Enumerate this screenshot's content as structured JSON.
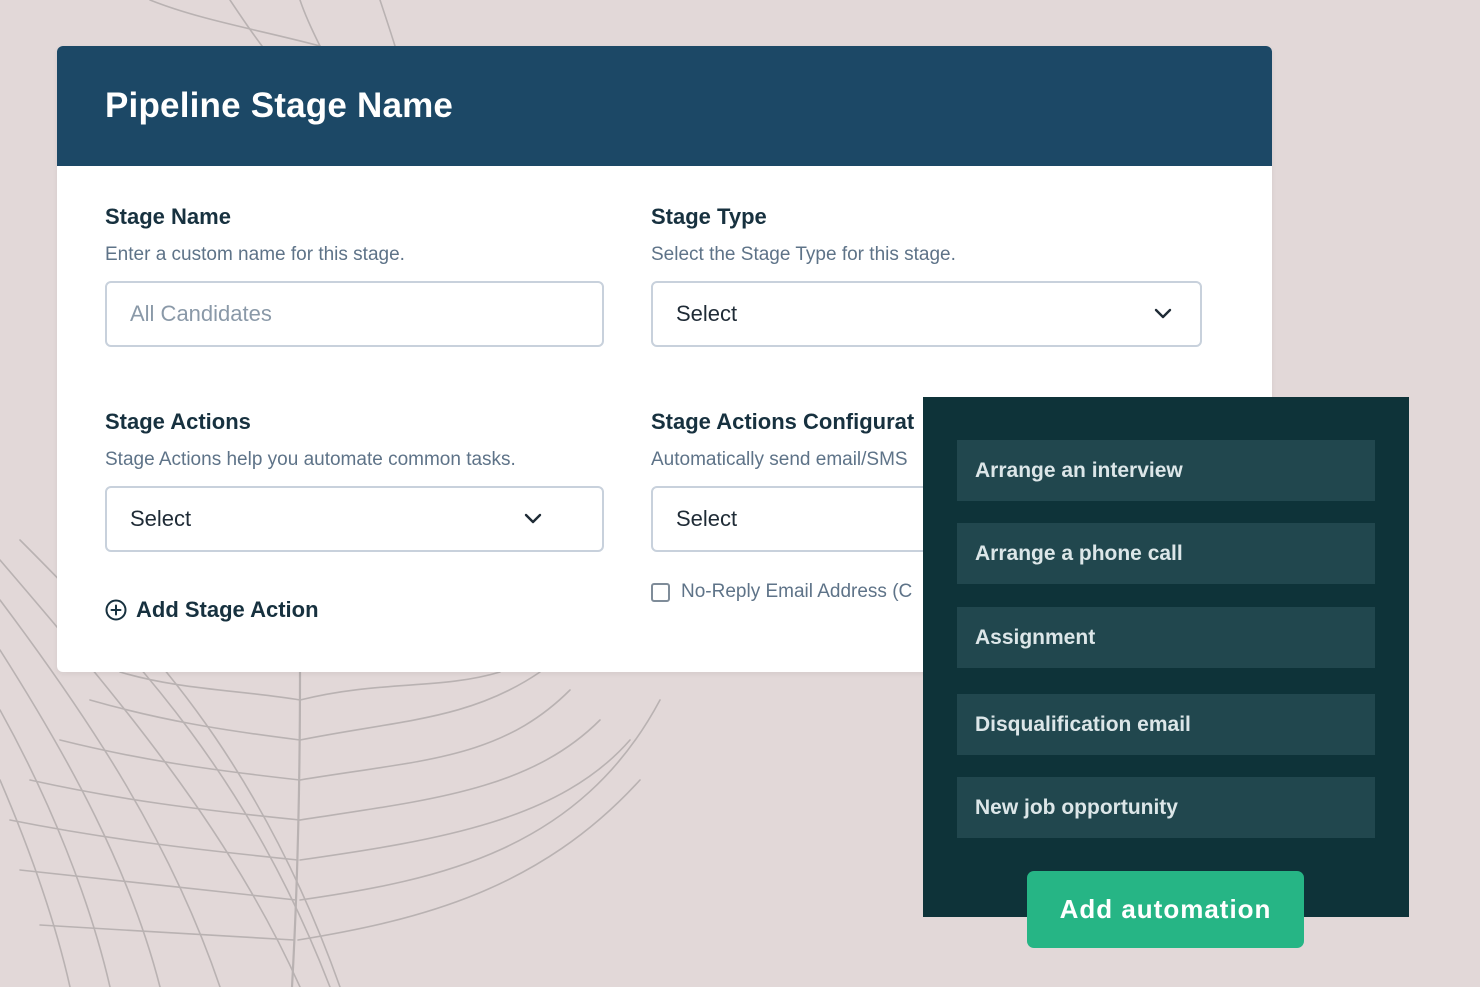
{
  "theme": {
    "background": "#e2d8d8",
    "header_bg": "#1c4866",
    "panel_bg": "#0e3339",
    "option_bg": "#21474e",
    "accent": "#26b585"
  },
  "card": {
    "title": "Pipeline Stage Name",
    "stage_name": {
      "label": "Stage Name",
      "help": "Enter a custom name for this stage.",
      "placeholder": "All Candidates",
      "value": ""
    },
    "stage_type": {
      "label": "Stage Type",
      "help": "Select the Stage Type for this stage.",
      "selected": "Select"
    },
    "stage_actions": {
      "label": "Stage Actions",
      "help": "Stage Actions help you automate common tasks.",
      "selected": "Select",
      "add_label": "Add Stage Action"
    },
    "stage_actions_config": {
      "label": "Stage Actions Configurat",
      "help": "Automatically send email/SMS",
      "selected": "Select",
      "no_reply_label": "No-Reply Email Address (C"
    }
  },
  "dropdown": {
    "options": [
      "Arrange an interview",
      "Arrange a phone call",
      "Assignment",
      "Disqualification email",
      "New job opportunity"
    ]
  },
  "add_automation_label": "Add automation"
}
